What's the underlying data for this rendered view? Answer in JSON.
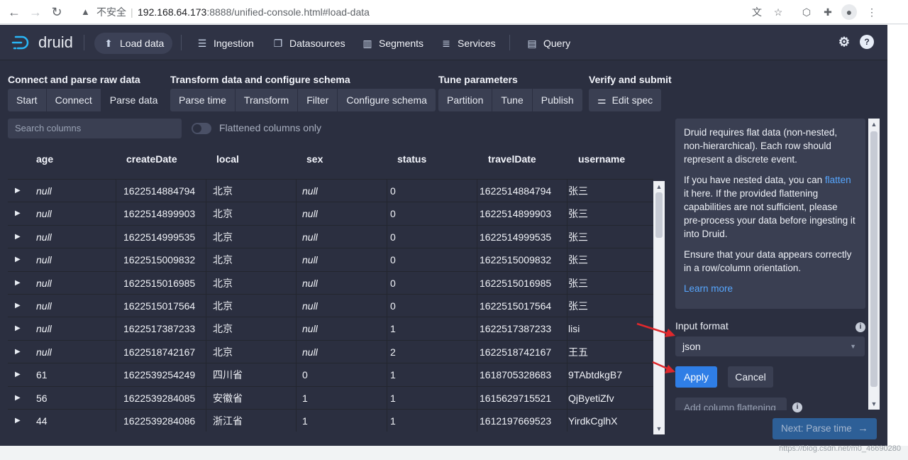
{
  "browser": {
    "insecure_label": "不安全",
    "separator": "|",
    "url_host": "192.168.64.173",
    "url_path": ":8888/unified-console.html#load-data"
  },
  "header": {
    "logo_text": "druid",
    "nav": [
      {
        "label": "Load data",
        "icon": "cloud-upload-icon"
      },
      {
        "label": "Ingestion",
        "icon": "gantt-chart-icon"
      },
      {
        "label": "Datasources",
        "icon": "multi-select-icon"
      },
      {
        "label": "Segments",
        "icon": "stacked-chart-icon"
      },
      {
        "label": "Services",
        "icon": "database-icon"
      },
      {
        "label": "Query",
        "icon": "application-icon"
      }
    ]
  },
  "steps": {
    "groups": [
      {
        "title": "Connect and parse raw data",
        "items": [
          "Start",
          "Connect",
          "Parse data"
        ]
      },
      {
        "title": "Transform data and configure schema",
        "items": [
          "Parse time",
          "Transform",
          "Filter",
          "Configure schema"
        ]
      },
      {
        "title": "Tune parameters",
        "items": [
          "Partition",
          "Tune",
          "Publish"
        ]
      },
      {
        "title": "Verify and submit",
        "items": [
          "Edit spec"
        ]
      }
    ],
    "active": "Parse data"
  },
  "table_controls": {
    "search_placeholder": "Search columns",
    "toggle_label": "Flattened columns only"
  },
  "table": {
    "columns": [
      "age",
      "createDate",
      "local",
      "sex",
      "status",
      "travelDate",
      "username"
    ],
    "rows": [
      {
        "age": "null",
        "createDate": "1622514884794",
        "local": "北京",
        "sex": "null",
        "status": "0",
        "travelDate": "1622514884794",
        "username": "张三"
      },
      {
        "age": "null",
        "createDate": "1622514899903",
        "local": "北京",
        "sex": "null",
        "status": "0",
        "travelDate": "1622514899903",
        "username": "张三"
      },
      {
        "age": "null",
        "createDate": "1622514999535",
        "local": "北京",
        "sex": "null",
        "status": "0",
        "travelDate": "1622514999535",
        "username": "张三"
      },
      {
        "age": "null",
        "createDate": "1622515009832",
        "local": "北京",
        "sex": "null",
        "status": "0",
        "travelDate": "1622515009832",
        "username": "张三"
      },
      {
        "age": "null",
        "createDate": "1622515016985",
        "local": "北京",
        "sex": "null",
        "status": "0",
        "travelDate": "1622515016985",
        "username": "张三"
      },
      {
        "age": "null",
        "createDate": "1622515017564",
        "local": "北京",
        "sex": "null",
        "status": "0",
        "travelDate": "1622515017564",
        "username": "张三"
      },
      {
        "age": "null",
        "createDate": "1622517387233",
        "local": "北京",
        "sex": "null",
        "status": "1",
        "travelDate": "1622517387233",
        "username": "lisi"
      },
      {
        "age": "null",
        "createDate": "1622518742167",
        "local": "北京",
        "sex": "null",
        "status": "2",
        "travelDate": "1622518742167",
        "username": "王五"
      },
      {
        "age": "61",
        "createDate": "1622539254249",
        "local": "四川省",
        "sex": "0",
        "status": "1",
        "travelDate": "1618705328683",
        "username": "9TAbtdkgB7"
      },
      {
        "age": "56",
        "createDate": "1622539284085",
        "local": "安徽省",
        "sex": "1",
        "status": "1",
        "travelDate": "1615629715521",
        "username": "QjByetiZfv"
      },
      {
        "age": "44",
        "createDate": "1622539284086",
        "local": "浙江省",
        "sex": "1",
        "status": "1",
        "travelDate": "1612197669523",
        "username": "YirdkCglhX"
      }
    ]
  },
  "panel": {
    "para1": "Druid requires flat data (non-nested, non-hierarchical). Each row should represent a discrete event.",
    "para2_before": "If you have nested data, you can ",
    "para2_link": "flatten",
    "para2_after": " it here. If the provided flattening capabilities are not sufficient, please pre-process your data before ingesting it into Druid.",
    "para3": "Ensure that your data appears correctly in a row/column orientation.",
    "learn_more": "Learn more"
  },
  "form": {
    "input_format_label": "Input format",
    "input_format_value": "json",
    "apply_label": "Apply",
    "cancel_label": "Cancel",
    "add_flattening_label": "Add column flattening",
    "next_label": "Next: Parse time"
  },
  "colors": {
    "app_bg": "#2b2f40",
    "control_bg": "#3a3f52",
    "primary": "#2f7ee6",
    "link": "#57a7ff",
    "annotation_arrow": "#e0282c"
  },
  "watermark": "https://blog.csdn.net/m0_46690280"
}
